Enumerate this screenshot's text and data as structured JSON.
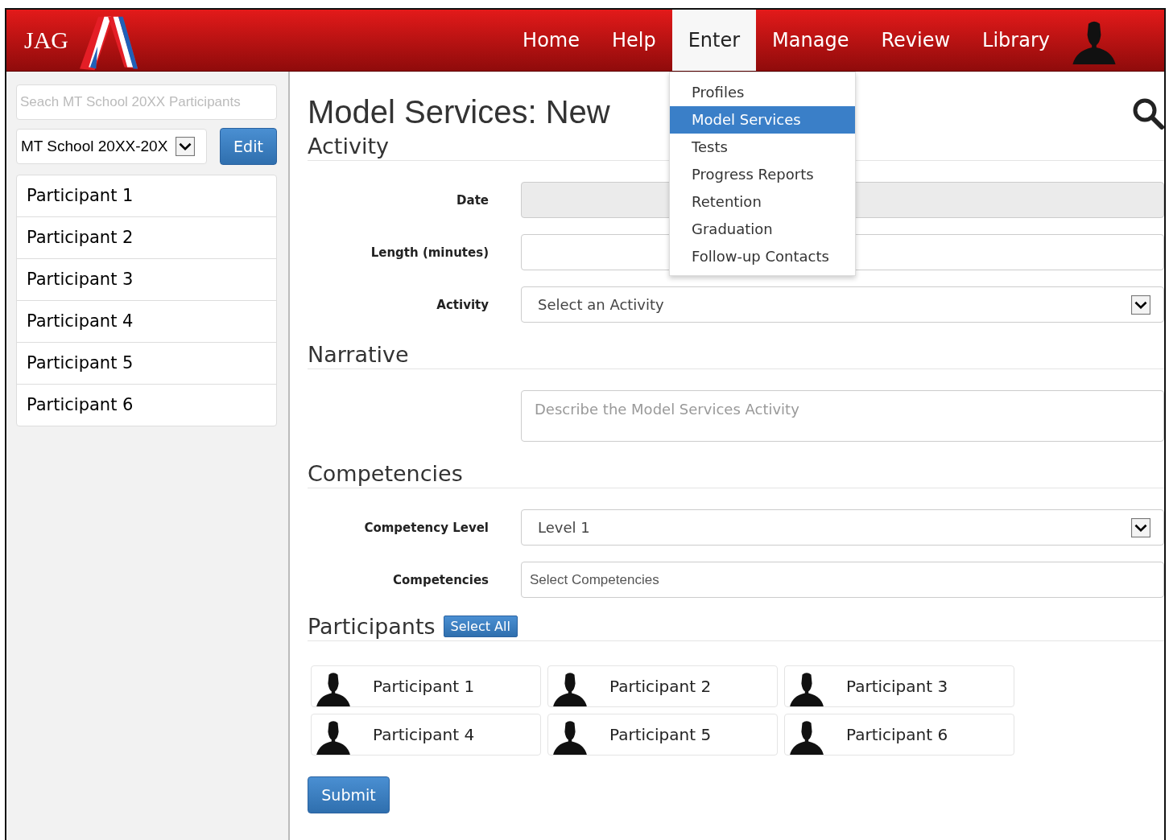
{
  "header": {
    "logo": "JAG",
    "nav": [
      {
        "label": "Home",
        "selected": false
      },
      {
        "label": "Help",
        "selected": false
      },
      {
        "label": "Enter",
        "selected": true
      },
      {
        "label": "Manage",
        "selected": false
      },
      {
        "label": "Review",
        "selected": false
      },
      {
        "label": "Library",
        "selected": false
      }
    ],
    "menu": [
      {
        "label": "Profiles",
        "selected": false
      },
      {
        "label": "Model Services",
        "selected": true
      },
      {
        "label": "Tests",
        "selected": false
      },
      {
        "label": "Progress Reports",
        "selected": false
      },
      {
        "label": "Retention",
        "selected": false
      },
      {
        "label": "Graduation",
        "selected": false
      },
      {
        "label": "Follow-up Contacts",
        "selected": false
      }
    ]
  },
  "sidebar": {
    "search": {
      "placeholder": "Seach MT School 20XX Participants"
    },
    "school": {
      "value": "MT School 20XX-20X"
    },
    "edit_button": "Edit",
    "items": [
      "Participant 1",
      "Participant 2",
      "Participant 3",
      "Participant 4",
      "Participant 5",
      "Participant 6"
    ]
  },
  "page_title": "Model Services: New",
  "sections": [
    {
      "title": "Activity",
      "fields": [
        {
          "label": "Date",
          "kind": "text",
          "disabled": true
        },
        {
          "label": "Length (minutes)",
          "kind": "text",
          "disabled": false
        },
        {
          "label": "Activity",
          "kind": "select",
          "value": "Select an Activity",
          "disabled": false
        }
      ]
    },
    {
      "title": "Narrative",
      "fields": [
        {
          "kind": "textarea",
          "placeholder": "Describe the Model Services Activity",
          "disabled": false
        }
      ]
    },
    {
      "title": "Competencies",
      "fields": [
        {
          "label": "Competency Level",
          "kind": "select",
          "value": "Level 1",
          "disabled": false
        },
        {
          "label": "Competencies",
          "kind": "text",
          "placeholder": "Select Competencies",
          "disabled": false
        }
      ]
    }
  ],
  "participants": {
    "title": "Participants",
    "select_all": "Select All",
    "items": [
      "Participant 1",
      "Participant 2",
      "Participant 3",
      "Participant 4",
      "Participant 5",
      "Participant 6"
    ]
  },
  "submit": "Submit"
}
